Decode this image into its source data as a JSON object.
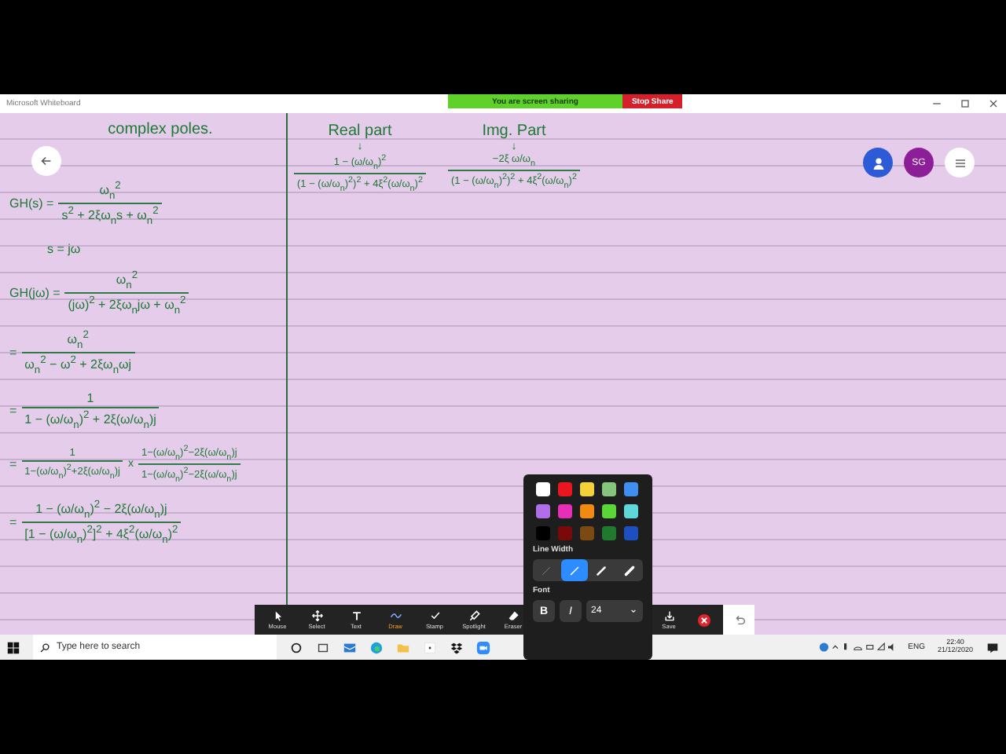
{
  "window": {
    "title": "Microsoft Whiteboard"
  },
  "share_bar": {
    "status": "You are screen sharing",
    "stop_button": "Stop Share"
  },
  "board": {
    "left": [
      {
        "kind": "heading",
        "text": "complex poles."
      },
      {
        "kind": "fraction",
        "lhs": "GH(s) =",
        "num": "ω$_{n}$$^{2}$",
        "den": "s$^{2}$ + 2ξω$_{n}$s + ω$_{n}$$^{2}$"
      },
      {
        "kind": "text",
        "text": "s = jω"
      },
      {
        "kind": "fraction",
        "lhs": "GH(jω) =",
        "num": "ω$_{n}$$^{2}$",
        "den": "(jω)$^{2}$ + 2ξω$_{n}$jω + ω$_{n}$$^{2}$"
      },
      {
        "kind": "fraction",
        "lhs": "=",
        "num": "ω$_{n}$$^{2}$",
        "den": "ω$_{n}$$^{2}$ − ω$^{2}$ + 2ξω$_{n}$ωj"
      },
      {
        "kind": "fraction",
        "lhs": "=",
        "num": "1",
        "den": "1 − (ω/ω$_{n}$)$^{2}$ + 2ξ(ω/ω$_{n}$)j"
      },
      {
        "kind": "product",
        "lhs": "=",
        "num": "1",
        "den": "1−(ω/ω$_{n}$)$^{2}$+2ξ(ω/ω$_{n}$)j",
        "times": "x",
        "num2": "1−(ω/ω$_{n}$)$^{2}$−2ξ(ω/ω$_{n}$)j",
        "den2": "1−(ω/ω$_{n}$)$^{2}$−2ξ(ω/ω$_{n}$)j"
      },
      {
        "kind": "fraction",
        "lhs": "=",
        "num": "1 − (ω/ω$_{n}$)$^{2}$ − 2ξ(ω/ω$_{n}$)j",
        "den": "[1 − (ω/ω$_{n}$)$^{2}$]$^{2}$ + 4ξ$^{2}$(ω/ω$_{n}$)$^{2}$"
      }
    ],
    "parts": [
      {
        "title": "Real part",
        "arrow": "↓",
        "num": "1 − (ω/ω$_{n}$)$^{2}$",
        "den": "(1 − (ω/ω$_{n}$)$^{2}$)$^{2}$ + 4ξ$^{2}$(ω/ω$_{n}$)$^{2}$"
      },
      {
        "title": "Img. Part",
        "arrow": "↓",
        "num": "−2ξ ω/ω$_{n}$",
        "den": "(1 − (ω/ω$_{n}$)$^{2}$)$^{2}$ + 4ξ$^{2}$(ω/ω$_{n}$)$^{2}$"
      }
    ]
  },
  "participants": [
    {
      "kind": "person",
      "color": "#2d5bd8"
    },
    {
      "kind": "initials",
      "initials": "SG",
      "color": "#8c1f98"
    }
  ],
  "toolbar": {
    "tools": [
      {
        "label": "Mouse",
        "kind": "pointer",
        "selected": false
      },
      {
        "label": "Select",
        "kind": "move",
        "selected": false
      },
      {
        "label": "Text",
        "kind": "text",
        "selected": false
      },
      {
        "label": "Draw",
        "kind": "draw",
        "selected": true
      },
      {
        "label": "Stamp",
        "kind": "stamp",
        "selected": false
      },
      {
        "label": "Spotlight",
        "kind": "spotlight",
        "selected": false
      },
      {
        "label": "Eraser",
        "kind": "eraser",
        "selected": false
      }
    ],
    "save": "Save"
  },
  "popup": {
    "colors": [
      {
        "color": "#ffffff"
      },
      {
        "color": "#e8161f"
      },
      {
        "color": "#f2d13a"
      },
      {
        "color": "#86c57c"
      },
      {
        "color": "#3f8ef0"
      },
      {
        "color": "#b06ee8"
      },
      {
        "color": "#e62fb8"
      },
      {
        "color": "#f08a10"
      },
      {
        "color": "#5bd639"
      },
      {
        "color": "#5fd6d8"
      },
      {
        "color": "#000000"
      },
      {
        "color": "#7a0a0a"
      },
      {
        "color": "#7a4a12"
      },
      {
        "color": "#1f7a2f"
      },
      {
        "color": "#1d4fbf"
      }
    ],
    "line_width_label": "Line Width",
    "line_widths": [
      {
        "kind": "thin",
        "selected": false
      },
      {
        "kind": "medium",
        "selected": true
      },
      {
        "kind": "thick",
        "selected": false
      },
      {
        "kind": "heavy",
        "selected": false
      }
    ],
    "font_label": "Font",
    "bold": "B",
    "italic": "I",
    "font_size": "24"
  },
  "taskbar": {
    "search_placeholder": "Type here to search",
    "language": "ENG",
    "time": "22:40",
    "date": "21/12/2020"
  }
}
